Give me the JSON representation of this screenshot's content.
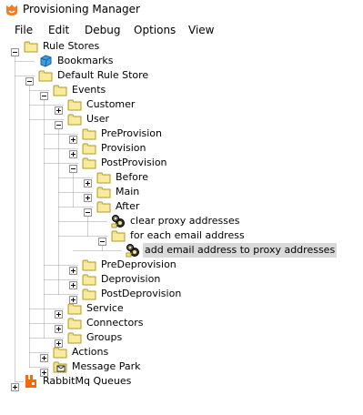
{
  "window": {
    "title": "Provisioning Manager"
  },
  "menu": {
    "items": [
      {
        "label": "File"
      },
      {
        "label": "Edit"
      },
      {
        "label": "Debug"
      },
      {
        "label": "Options"
      },
      {
        "label": "View"
      }
    ]
  },
  "tree": {
    "nodes": [
      {
        "label": "Rule Stores",
        "icon": "folder-icon",
        "expanded": true
      },
      {
        "label": "Bookmarks",
        "icon": "bookmark-icon"
      },
      {
        "label": "Default Rule Store",
        "icon": "folder-icon",
        "expanded": true
      },
      {
        "label": "Events",
        "icon": "folder-icon",
        "expanded": true
      },
      {
        "label": "Customer",
        "icon": "folder-icon",
        "expanded": false
      },
      {
        "label": "User",
        "icon": "folder-icon",
        "expanded": true
      },
      {
        "label": "PreProvision",
        "icon": "folder-icon",
        "expanded": false
      },
      {
        "label": "Provision",
        "icon": "folder-icon",
        "expanded": false
      },
      {
        "label": "PostProvision",
        "icon": "folder-icon",
        "expanded": true
      },
      {
        "label": "Before",
        "icon": "folder-icon",
        "expanded": false
      },
      {
        "label": "Main",
        "icon": "folder-icon",
        "expanded": false
      },
      {
        "label": "After",
        "icon": "folder-icon",
        "expanded": true
      },
      {
        "label": "clear proxy addresses",
        "icon": "gear-rule-icon"
      },
      {
        "label": "for each email address",
        "icon": "folder-icon",
        "expanded": true
      },
      {
        "label": "add email address to proxy addresses",
        "icon": "gear-rule-icon",
        "selected": true
      },
      {
        "label": "PreDeprovision",
        "icon": "folder-icon",
        "expanded": false
      },
      {
        "label": "Deprovision",
        "icon": "folder-icon",
        "expanded": false
      },
      {
        "label": "PostDeprovision",
        "icon": "folder-icon",
        "expanded": false
      },
      {
        "label": "Service",
        "icon": "folder-icon",
        "expanded": false
      },
      {
        "label": "Connectors",
        "icon": "folder-icon",
        "expanded": false
      },
      {
        "label": "Groups",
        "icon": "folder-icon",
        "expanded": false
      },
      {
        "label": "Actions",
        "icon": "folder-icon",
        "expanded": false
      },
      {
        "label": "Message Park",
        "icon": "message-park-icon",
        "expanded": false
      },
      {
        "label": "RabbitMq Queues",
        "icon": "rabbitmq-icon",
        "expanded": false
      }
    ]
  },
  "colors": {
    "folder": "#f5e08a",
    "folder_edge": "#b39b2f",
    "tree_line": "#a0a0a0",
    "selection": "#d9d9d9",
    "app_icon": "#f07c2a",
    "rabbitmq": "#ff6600",
    "bookmark": "#3a9ee4"
  }
}
